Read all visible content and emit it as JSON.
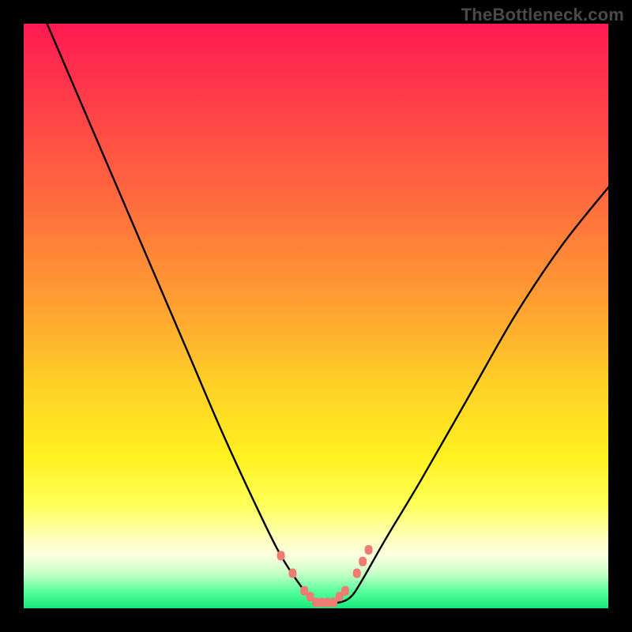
{
  "watermark": "TheBottleneck.com",
  "chart_data": {
    "type": "line",
    "title": "",
    "xlabel": "",
    "ylabel": "",
    "xlim": [
      0,
      100
    ],
    "ylim": [
      0,
      100
    ],
    "grid": false,
    "legend": false,
    "series": [
      {
        "name": "bottleneck-curve",
        "x": [
          4,
          10,
          16,
          22,
          28,
          34,
          40,
          44,
          48,
          50,
          52,
          54,
          56,
          58,
          62,
          68,
          76,
          84,
          92,
          100
        ],
        "y": [
          100,
          86,
          72,
          58,
          44,
          30,
          17,
          9,
          3,
          1,
          1,
          1,
          2,
          5,
          12,
          22,
          36,
          50,
          62,
          72
        ]
      }
    ],
    "markers": {
      "name": "highlight-dots",
      "color": "#ee7c72",
      "x": [
        44,
        46,
        48,
        49,
        50,
        51,
        52,
        53,
        54,
        55,
        57,
        58,
        59
      ],
      "y": [
        9,
        6,
        3,
        2,
        1,
        1,
        1,
        1,
        2,
        3,
        6,
        8,
        10
      ]
    },
    "background_gradient": {
      "top": "#ff1a52",
      "mid": "#ffd127",
      "bottom": "#17e87a"
    }
  }
}
